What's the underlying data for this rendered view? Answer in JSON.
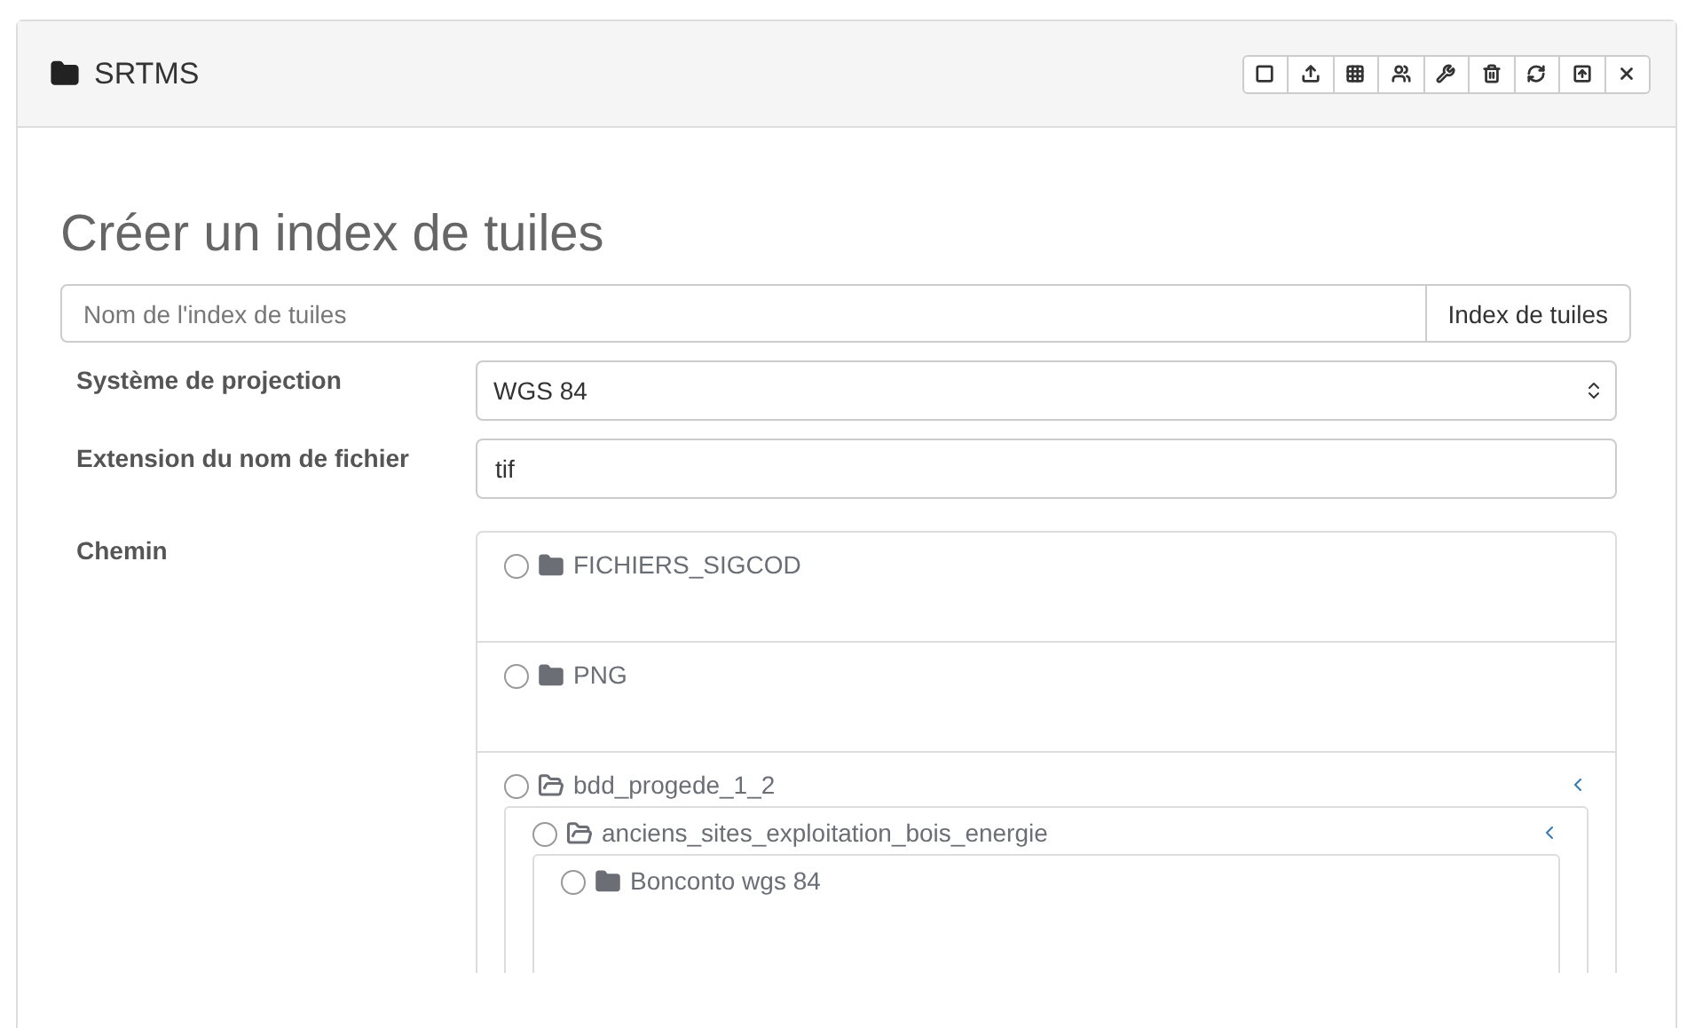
{
  "panel": {
    "title": "SRTMS"
  },
  "heading": "Créer un index de tuiles",
  "index_field": {
    "placeholder": "Nom de l'index de tuiles",
    "addon": "Index de tuiles"
  },
  "fields": [
    {
      "kind": "select",
      "label": "Système de projection",
      "value": "WGS 84"
    },
    {
      "kind": "text",
      "label": "Extension du nom de fichier",
      "value": "tif"
    },
    {
      "kind": "tree",
      "label": "Chemin"
    }
  ],
  "tree": [
    {
      "name": "FICHIERS_SIGCOD",
      "selected": false,
      "expanded": false
    },
    {
      "name": "PNG",
      "selected": false,
      "expanded": false
    },
    {
      "name": "bdd_progede_1_2",
      "selected": false,
      "expanded": true,
      "children": [
        {
          "name": "anciens_sites_exploitation_bois_energie",
          "selected": false,
          "expanded": true,
          "children": [
            {
              "name": "Bonconto wgs 84",
              "selected": false,
              "expanded": false
            }
          ]
        }
      ]
    }
  ]
}
